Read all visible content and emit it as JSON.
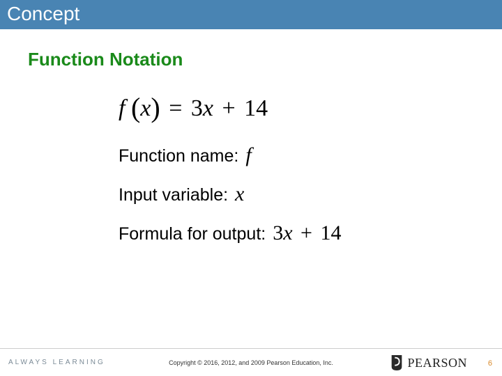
{
  "header": {
    "title": "Concept"
  },
  "section": {
    "title": "Function Notation"
  },
  "equation": {
    "f": "f",
    "lparen": "(",
    "x": "x",
    "rparen": ")",
    "eq": "=",
    "coef": "3",
    "var": "x",
    "plus": "+",
    "const": "14"
  },
  "rows": {
    "name_label": "Function name:",
    "name_value": "f",
    "input_label": "Input variable:",
    "input_value": "x",
    "formula_label": "Formula for output:",
    "formula_coef": "3",
    "formula_var": "x",
    "formula_plus": "+",
    "formula_const": "14"
  },
  "footer": {
    "left": "ALWAYS LEARNING",
    "copyright": "Copyright © 2016, 2012, and 2009 Pearson Education, Inc.",
    "brand": "PEARSON",
    "page": "6"
  }
}
